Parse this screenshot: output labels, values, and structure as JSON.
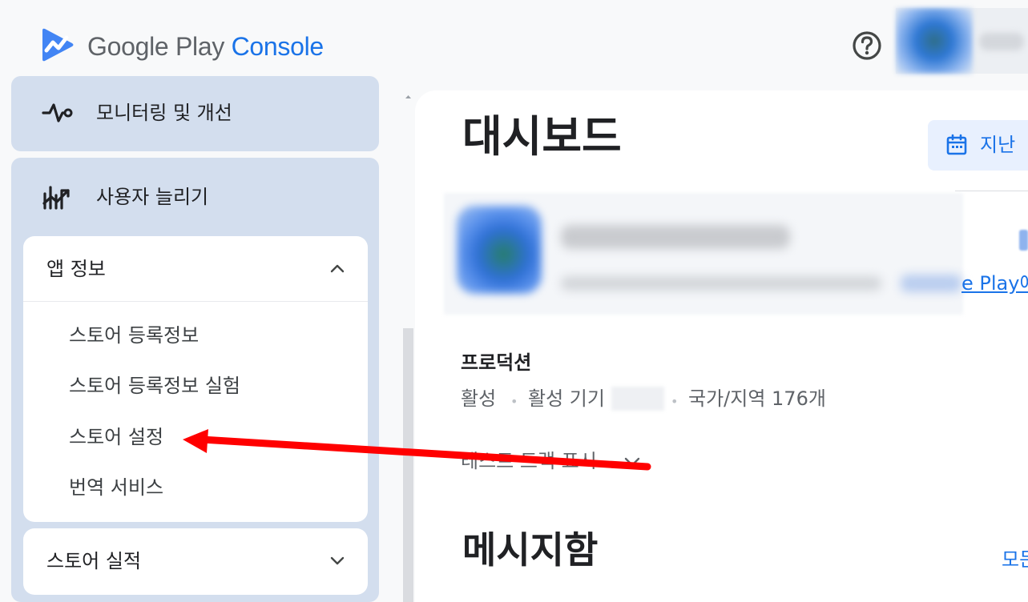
{
  "app": {
    "logo_google_play": "Google Play",
    "logo_console": "Console"
  },
  "sidebar": {
    "monitoring_label": "모니터링 및 개선",
    "grow_users_label": "사용자 늘리기",
    "app_info": {
      "title": "앱 정보",
      "expanded": true,
      "items": [
        {
          "label": "스토어 등록정보"
        },
        {
          "label": "스토어 등록정보 실험"
        },
        {
          "label": "스토어 설정"
        },
        {
          "label": "번역 서비스"
        }
      ]
    },
    "store_performance": {
      "title": "스토어 실적",
      "expanded": false
    }
  },
  "main": {
    "title": "대시보드",
    "date_button_label": "지난 ",
    "app_card": {
      "link_text": "e Play에"
    },
    "production": {
      "title": "프로덕션",
      "status": "활성",
      "active_devices_label": "활성 기기",
      "countries": "국가/지역 176개"
    },
    "track_toggle_label": "테스트 트랙 표시",
    "inbox_title": "메시지함",
    "inbox_view_all": "모든"
  },
  "annotation": {
    "arrow_color": "#ff0000",
    "arrow_target": "스토어 설정"
  },
  "colors": {
    "accent": "#1a73e8",
    "sidebar_card": "#d3deee",
    "page_bg": "#f8f9fa"
  },
  "icons": {
    "logo": "play-console-logo-icon",
    "help": "help-icon",
    "monitoring": "pulse-icon",
    "grow": "growth-chart-icon",
    "calendar": "calendar-icon"
  }
}
